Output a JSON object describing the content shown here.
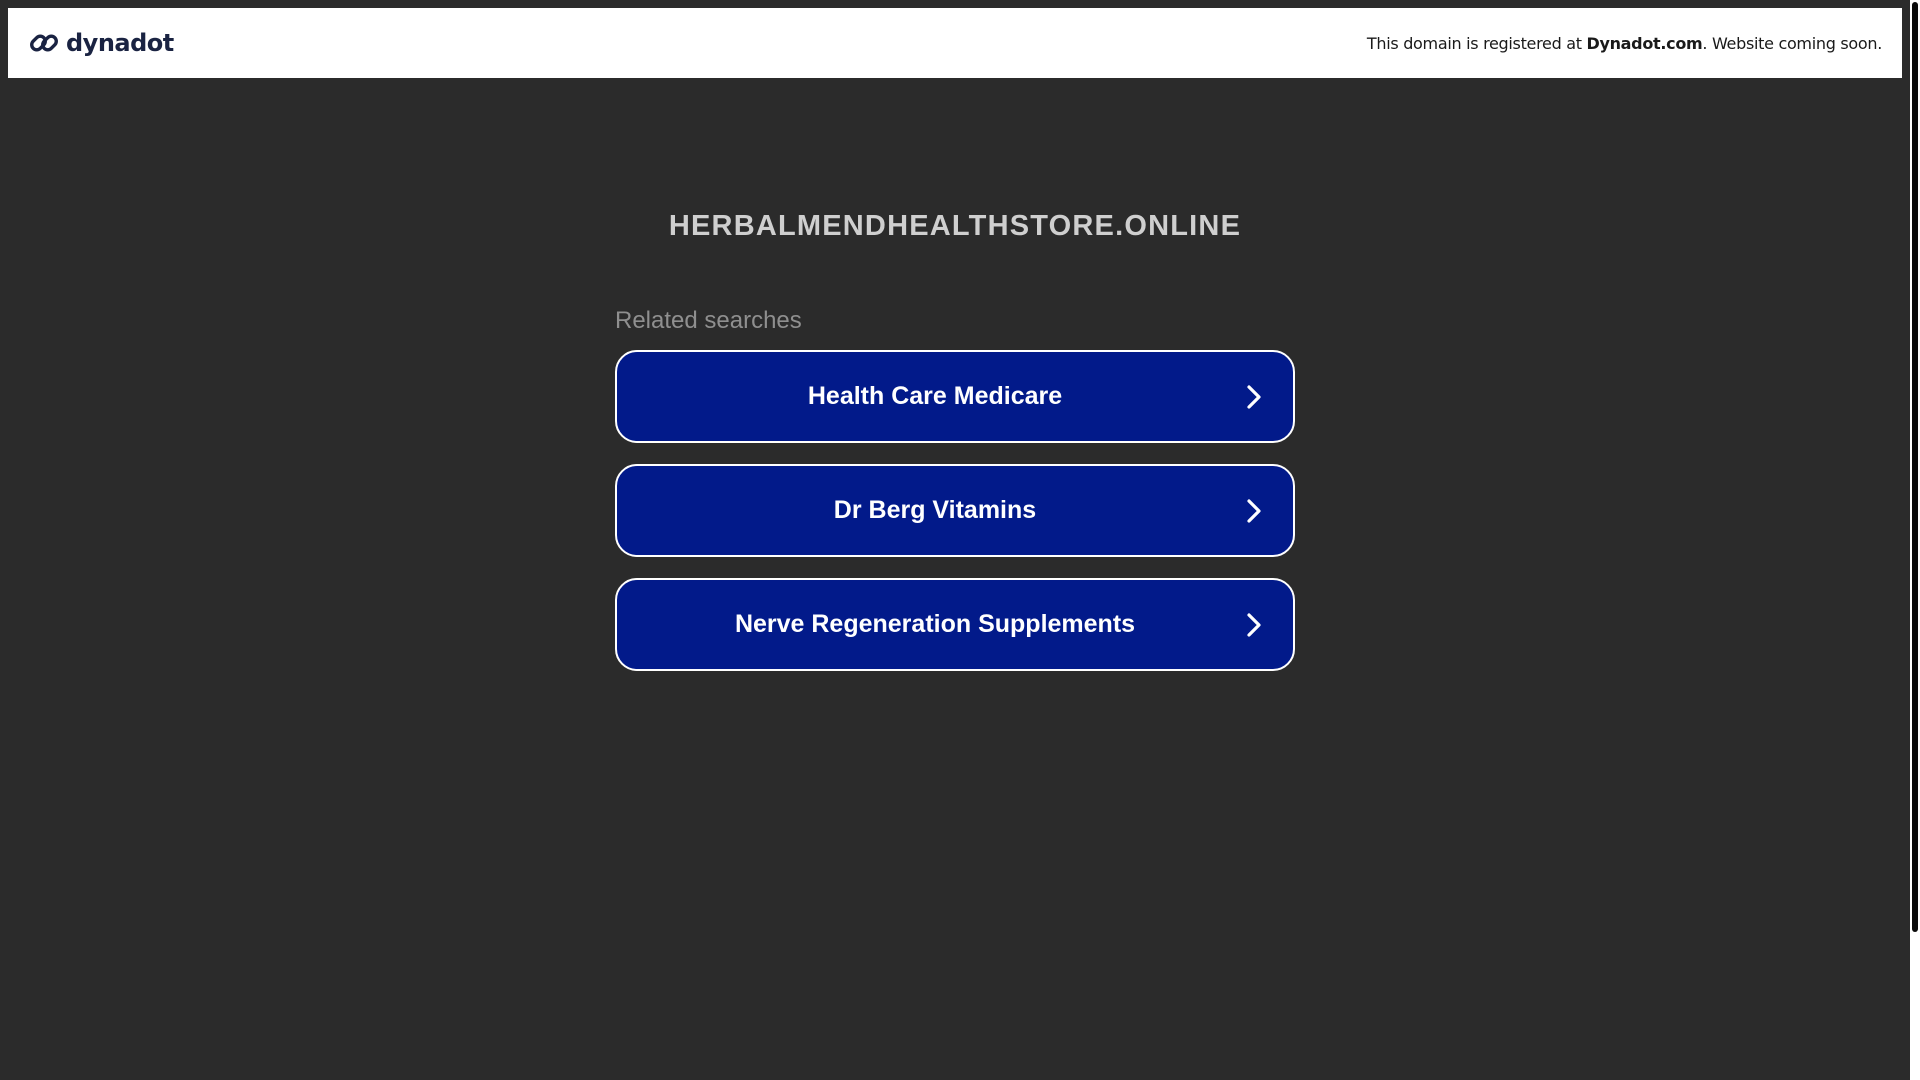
{
  "header": {
    "brand_name": "dynadot",
    "brand_icon": "chain-link-icon",
    "notice_prefix": "This domain is registered at ",
    "notice_link": "Dynadot.com",
    "notice_suffix": ". Website coming soon."
  },
  "main": {
    "domain": "HERBALMENDHEALTHSTORE.ONLINE",
    "related_label": "Related searches",
    "links": [
      {
        "label": "Health Care Medicare",
        "icon": "chevron-right-icon"
      },
      {
        "label": "Dr Berg Vitamins",
        "icon": "chevron-right-icon"
      },
      {
        "label": "Nerve Regeneration Supplements",
        "icon": "chevron-right-icon"
      }
    ]
  },
  "colors": {
    "background": "#2b2b2b",
    "button_fill": "#021a8a",
    "button_border": "#ffffff",
    "title_text": "#cfcfcf",
    "related_text": "#8f8f8f",
    "brand_text": "#1a2342"
  }
}
